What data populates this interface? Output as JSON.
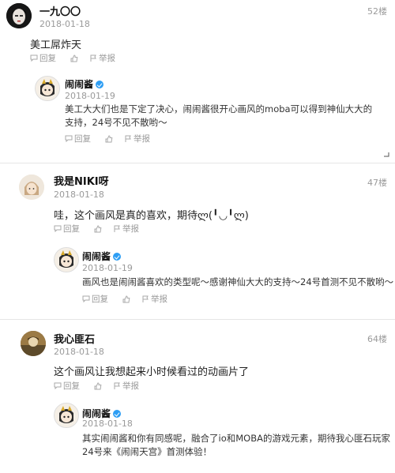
{
  "actions": {
    "reply": "回复",
    "report": "举报"
  },
  "comments": [
    {
      "username": "一九〇〇",
      "date": "2018-01-18",
      "floor": "52楼",
      "text": "美工屌炸天",
      "reply": {
        "username": "闹闹酱",
        "date": "2018-01-19",
        "text": "美工大大们也是下定了决心，闹闹酱很开心画风的moba可以得到神仙大大的支持，24号不见不散哟～"
      }
    },
    {
      "username": "我是NIKI呀",
      "date": "2018-01-18",
      "floor": "47楼",
      "text": "哇，这个画风是真的喜欢，期待ლ(╹◡╹ლ)",
      "reply": {
        "username": "闹闹酱",
        "date": "2018-01-19",
        "text": "画风也是闹闹酱喜欢的类型呢～感谢神仙大大的支持～24号首测不见不散哟～"
      }
    },
    {
      "username": "我心匪石",
      "date": "2018-01-18",
      "floor": "64楼",
      "text": "这个画风让我想起来小时候看过的动画片了",
      "reply": {
        "username": "闹闹酱",
        "date": "2018-01-18",
        "text": "其实闹闹酱和你有同感呢，融合了io和MOBA的游戏元素，期待我心匪石玩家24号来《闹闹天宫》首测体验！"
      }
    }
  ]
}
